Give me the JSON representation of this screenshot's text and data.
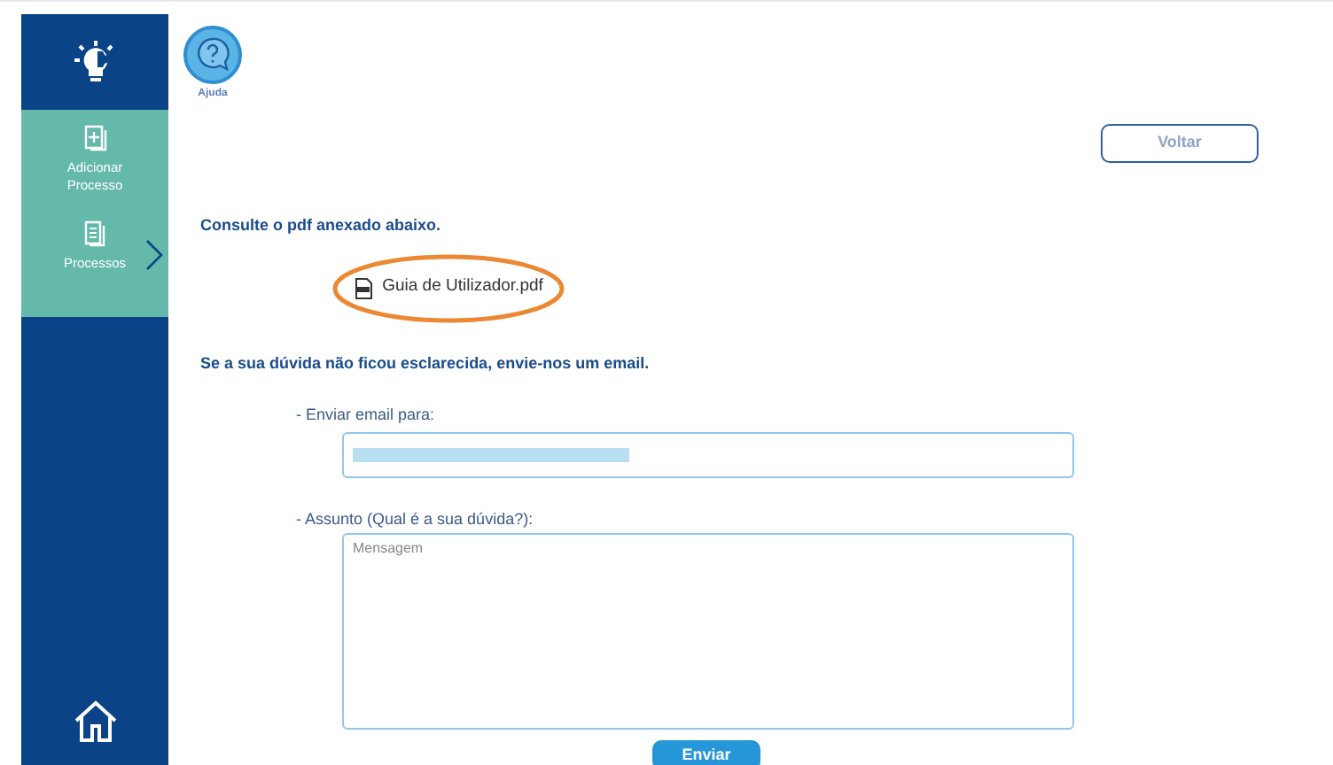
{
  "sidebar": {
    "items": [
      {
        "label": "Adicionar Processo",
        "kind": "add"
      },
      {
        "label": "Processos",
        "kind": "list"
      }
    ]
  },
  "help": {
    "label": "Ajuda"
  },
  "back_button": "Voltar",
  "pdf_section": {
    "heading": "Consulte o pdf anexado abaixo.",
    "file": "Guia de Utilizador.pdf"
  },
  "email_section": {
    "heading": "Se a sua dúvida não ficou esclarecida, envie-nos um email.",
    "email_label": "- Enviar email para:",
    "subject_label": "- Assunto (Qual é a sua dúvida?):",
    "message_placeholder": "Mensagem",
    "send_button": "Enviar"
  }
}
